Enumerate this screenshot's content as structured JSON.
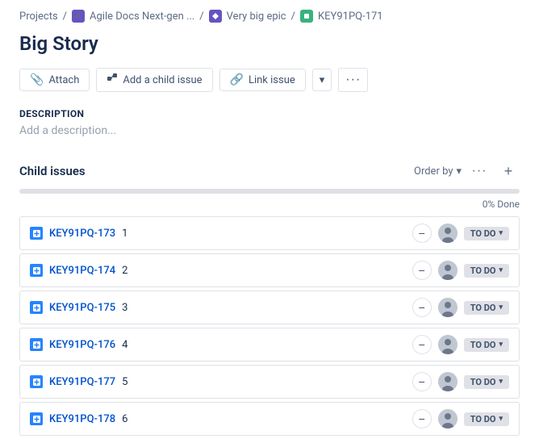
{
  "breadcrumb": {
    "projects_label": "Projects",
    "sep1": "/",
    "agile_label": "Agile Docs Next-gen ...",
    "sep2": "/",
    "epic_label": "Very big epic",
    "sep3": "/",
    "story_label": "KEY91PQ-171"
  },
  "page_title": "Big Story",
  "toolbar": {
    "attach_label": "Attach",
    "add_child_label": "Add a child issue",
    "link_issue_label": "Link issue",
    "dropdown_chevron": "▾",
    "more_dots": "···"
  },
  "description": {
    "section_label": "Description",
    "placeholder": "Add a description..."
  },
  "child_issues": {
    "title": "Child issues",
    "order_by_label": "Order by",
    "chevron": "▾",
    "dots": "···",
    "plus": "+",
    "progress_percent": 0,
    "progress_label": "0% Done",
    "items": [
      {
        "key": "KEY91PQ-173",
        "number": "1",
        "status": "TO DO"
      },
      {
        "key": "KEY91PQ-174",
        "number": "2",
        "status": "TO DO"
      },
      {
        "key": "KEY91PQ-175",
        "number": "3",
        "status": "TO DO"
      },
      {
        "key": "KEY91PQ-176",
        "number": "4",
        "status": "TO DO"
      },
      {
        "key": "KEY91PQ-177",
        "number": "5",
        "status": "TO DO"
      },
      {
        "key": "KEY91PQ-178",
        "number": "6",
        "status": "TO DO"
      }
    ]
  }
}
